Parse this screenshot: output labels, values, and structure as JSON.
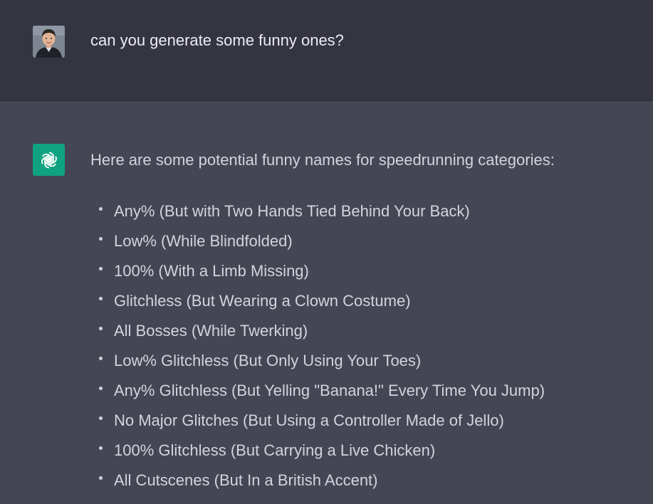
{
  "conversation": {
    "user_message": {
      "text": "can you generate some funny ones?",
      "avatar_icon": "user-avatar"
    },
    "assistant_message": {
      "avatar_icon": "openai-logo-icon",
      "intro": "Here are some potential funny names for speedrunning categories:",
      "items": [
        "Any% (But with Two Hands Tied Behind Your Back)",
        "Low% (While Blindfolded)",
        "100% (With a Limb Missing)",
        "Glitchless (But Wearing a Clown Costume)",
        "All Bosses (While Twerking)",
        "Low% Glitchless (But Only Using Your Toes)",
        "Any% Glitchless (But Yelling \"Banana!\" Every Time You Jump)",
        "No Major Glitches (But Using a Controller Made of Jello)",
        "100% Glitchless (But Carrying a Live Chicken)",
        "All Cutscenes (But In a British Accent)"
      ]
    }
  },
  "colors": {
    "user_bg": "#343541",
    "assistant_bg": "#444654",
    "text": "#d1d5db",
    "brand": "#10a37f"
  }
}
